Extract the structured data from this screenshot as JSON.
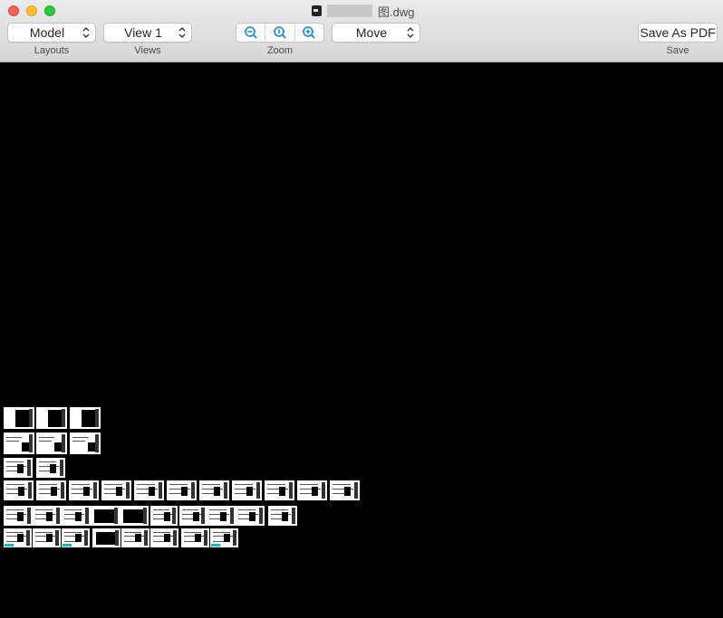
{
  "window": {
    "title": "图.dwg",
    "doc_icon": "document-icon"
  },
  "toolbar": {
    "layouts": {
      "value": "Model",
      "caption": "Layouts"
    },
    "views": {
      "value": "View 1",
      "caption": "Views"
    },
    "zoom": {
      "caption": "Zoom",
      "buttons": [
        "zoom-out-icon",
        "zoom-actual-icon",
        "zoom-in-icon"
      ]
    },
    "mode": {
      "value": "Move"
    },
    "save": {
      "label": "Save As PDF",
      "caption": "Save"
    }
  },
  "colors": {
    "canvas": "#000000",
    "accent_icon": "#2b8fd6",
    "sheet": "#ffffff",
    "highlight": "#1bb3c8"
  }
}
